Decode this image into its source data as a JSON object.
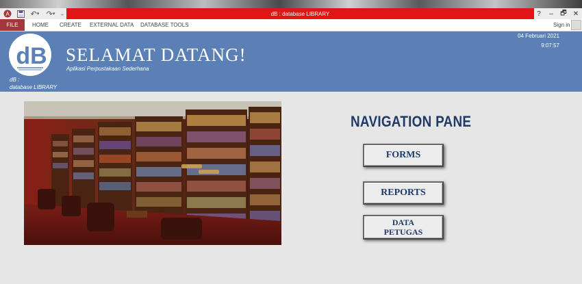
{
  "window": {
    "title": "dB : database LIBRARY",
    "controls": {
      "help": "?",
      "minimize": "–",
      "restore": "🗗",
      "close": "✕"
    }
  },
  "quick_access": {
    "save_icon": "save-icon",
    "undo_icon": "undo-icon",
    "redo_icon": "redo-icon"
  },
  "ribbon": {
    "file": "FILE",
    "tabs": [
      "HOME",
      "CREATE",
      "EXTERNAL DATA",
      "DATABASE TOOLS"
    ],
    "sign_in": "Sign in"
  },
  "header": {
    "logo_text": "dB",
    "db_label_line1": "dB :",
    "db_label_line2": "database LIBRARY",
    "welcome": "SELAMAT DATANG!",
    "subtitle": "Aplikasi Perpustakaan Sederhana",
    "date": "04 Februari 2021",
    "time": "9:07:57"
  },
  "navigation": {
    "title": "NAVIGATION PANE",
    "buttons": [
      {
        "label_line1": "FORMS",
        "label_line2": ""
      },
      {
        "label_line1": "REPORTS",
        "label_line2": ""
      },
      {
        "label_line1": "DATA",
        "label_line2": "PETUGAS"
      }
    ]
  },
  "colors": {
    "header_bg": "#5b80b5",
    "title_bar_red": "#e01515",
    "file_tab": "#a4373a",
    "nav_text": "#1f3a68"
  }
}
